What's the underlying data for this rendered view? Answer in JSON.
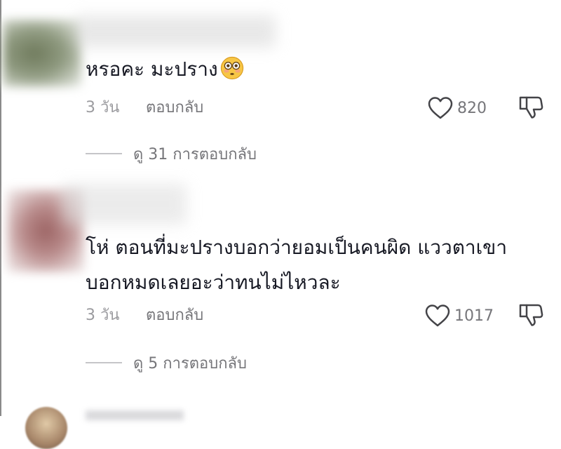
{
  "comments": [
    {
      "text": "หรอคะ มะปราง",
      "emoji": "flushed-face-emoji",
      "time": "3 วัน",
      "reply_label": "ตอบกลับ",
      "likes": "820",
      "view_replies": "ดู 31 การตอบกลับ",
      "avatar_color": "#6f7a5c"
    },
    {
      "text_lines": [
        "โห่ ตอนที่มะปรางบอกว่ายอมเป็นคนผิด แววตาเขา",
        "บอกหมดเลยอะว่าทนไม่ไหวละ"
      ],
      "time": "3 วัน",
      "reply_label": "ตอบกลับ",
      "likes": "1017",
      "view_replies": "ดู 5 การตอบกลับ",
      "avatar_color": "#9c6464"
    }
  ],
  "icons": {
    "like": "heart-outline-icon",
    "dislike": "thumbs-down-outline-icon"
  },
  "colors": {
    "text_primary": "#161823",
    "text_secondary": "#76767a",
    "text_time": "#9b9b9f",
    "emoji_face": "#f7c645"
  }
}
